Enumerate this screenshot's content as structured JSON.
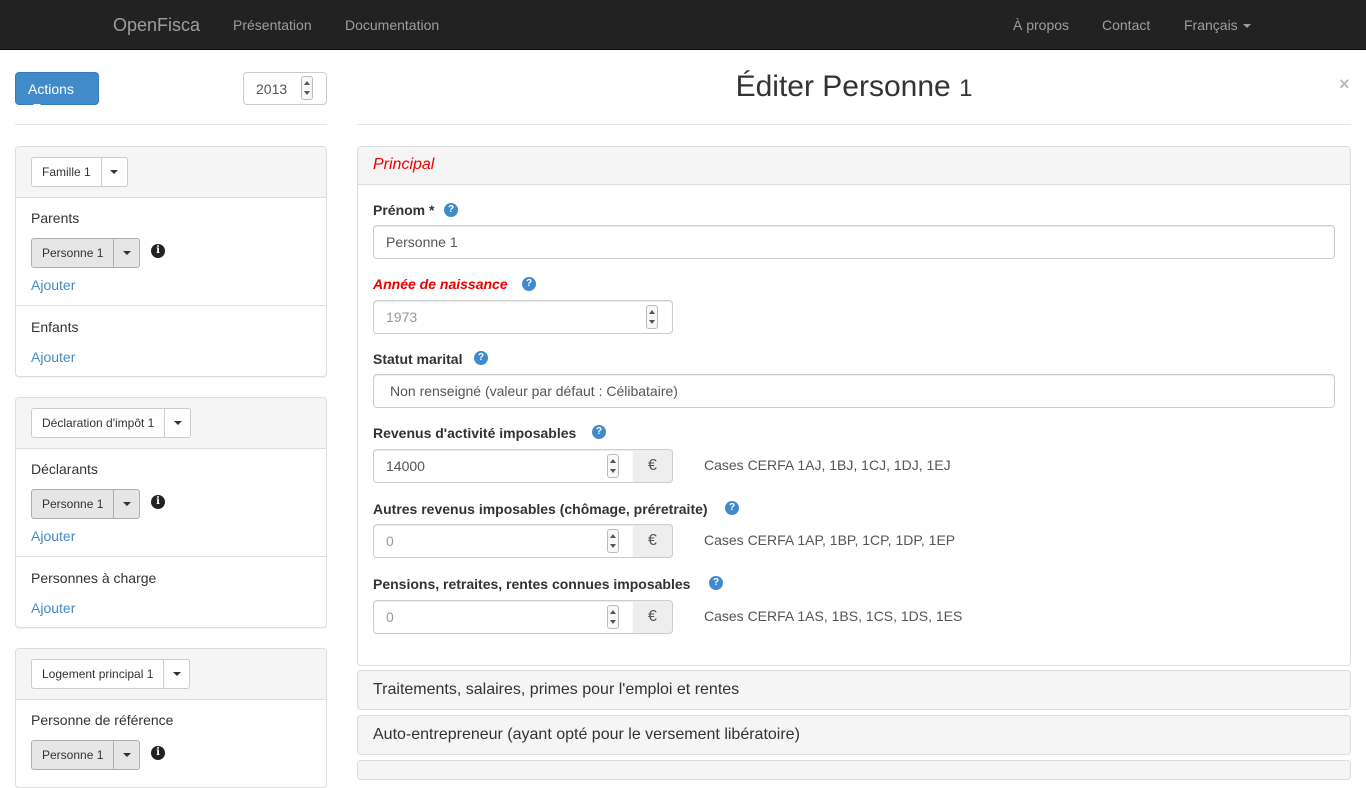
{
  "navbar": {
    "brand": "OpenFisca",
    "presentation": "Présentation",
    "documentation": "Documentation",
    "about": "À propos",
    "contact": "Contact",
    "language": "Français"
  },
  "toolbar": {
    "actions_label": "Actions",
    "year": "2013"
  },
  "famille_panel": {
    "entity_label": "Famille 1",
    "parents_title": "Parents",
    "parents_person": "Personne 1",
    "parents_add": "Ajouter",
    "enfants_title": "Enfants",
    "enfants_add": "Ajouter"
  },
  "declaration_panel": {
    "entity_label": "Déclaration d'impôt 1",
    "declarants_title": "Déclarants",
    "declarants_person": "Personne 1",
    "declarants_add": "Ajouter",
    "charge_title": "Personnes à charge",
    "charge_add": "Ajouter"
  },
  "logement_panel": {
    "entity_label": "Logement principal 1",
    "reference_title": "Personne de référence",
    "reference_person": "Personne 1"
  },
  "editor": {
    "title_main": "Éditer Personne",
    "title_num": "1",
    "close": "×",
    "principal_heading": "Principal",
    "prenom_label": "Prénom *",
    "prenom_value": "Personne 1",
    "naissance_label": "Année de naissance",
    "naissance_placeholder": "1973",
    "statut_label": "Statut marital",
    "statut_value": "Non renseigné (valeur par défaut : Célibataire)",
    "revenus_label": "Revenus d'activité imposables",
    "revenus_value": "14000",
    "revenus_cerfa": "Cases CERFA 1AJ, 1BJ, 1CJ, 1DJ, 1EJ",
    "autres_label": "Autres revenus imposables (chômage, préretraite)",
    "autres_placeholder": "0",
    "autres_cerfa": "Cases CERFA 1AP, 1BP, 1CP, 1DP, 1EP",
    "pensions_label": "Pensions, retraites, rentes connues imposables",
    "pensions_placeholder": "0",
    "pensions_cerfa": "Cases CERFA 1AS, 1BS, 1CS, 1DS, 1ES",
    "currency": "€",
    "help_glyph": "?",
    "info_glyph": "i"
  },
  "sections": {
    "traitements": "Traitements, salaires, primes pour l'emploi et rentes",
    "auto_entrepreneur": "Auto-entrepreneur (ayant opté pour le versement libératoire)"
  },
  "colors": {
    "navbar_bg": "#222222",
    "primary": "#428bca",
    "error": "#ee0000"
  }
}
